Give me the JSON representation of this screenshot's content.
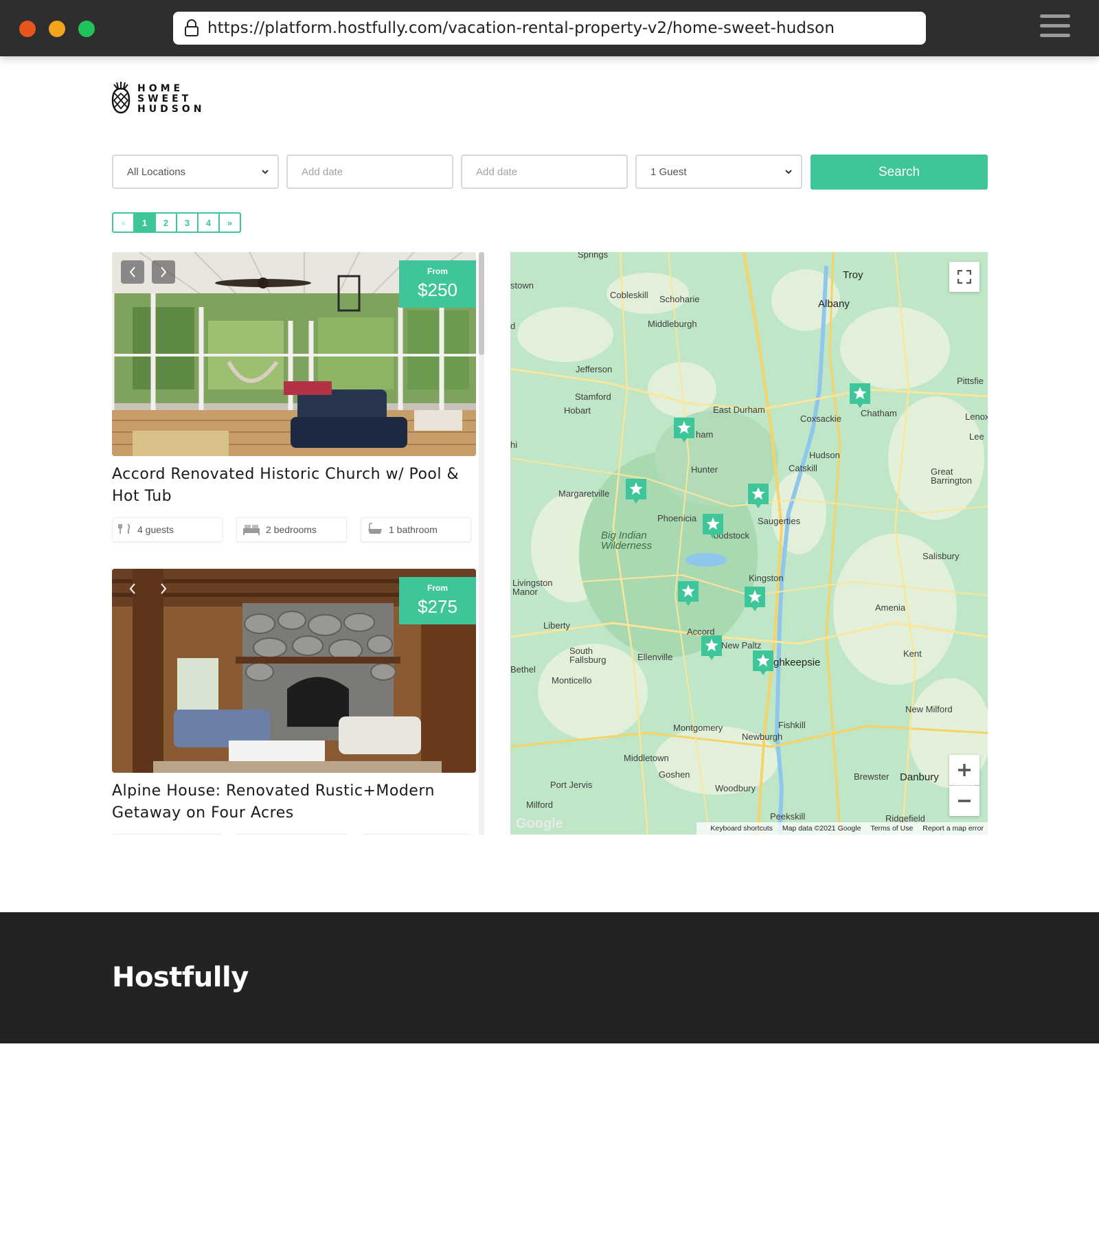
{
  "browser": {
    "url": "https://platform.hostfully.com/vacation-rental-property-v2/home-sweet-hudson"
  },
  "brand": {
    "line1": "HOME",
    "line2": "SWEET",
    "line3": "HUDSON"
  },
  "search": {
    "location_value": "All Locations",
    "checkin_placeholder": "Add date",
    "checkout_placeholder": "Add date",
    "guests_value": "1 Guest",
    "button_label": "Search"
  },
  "pagination": {
    "prev": "«",
    "pages": [
      "1",
      "2",
      "3",
      "4"
    ],
    "next": "»",
    "active": "1"
  },
  "listings": [
    {
      "price_prefix": "From",
      "price": "$250",
      "title": "Accord Renovated Historic Church w/ Pool & Hot Tub",
      "guests": "4 guests",
      "bedrooms": "2 bedrooms",
      "bathrooms": "1 bathroom"
    },
    {
      "price_prefix": "From",
      "price": "$275",
      "title": "Alpine House: Renovated Rustic+Modern Getaway on Four Acres"
    }
  ],
  "map": {
    "labels": {
      "springs": "Springs",
      "stown": "stown",
      "cobleskill": "Cobleskill",
      "schoharie": "Schoharie",
      "middleburgh": "Middleburgh",
      "troy": "Troy",
      "albany": "Albany",
      "jefferson": "Jefferson",
      "stamford": "Stamford",
      "hobart": "Hobart",
      "east_durham": "East Durham",
      "coxsackie": "Coxsackie",
      "chatham": "Chatham",
      "pittsfield": "Pittsfie",
      "lenox": "Lenox",
      "lee": "Lee",
      "durham": "ham",
      "hunter": "Hunter",
      "catskill": "Catskill",
      "hudson": "Hudson",
      "great_barrington": "Great Barrington",
      "margaretville": "Margaretville",
      "phoenicia": "Phoenicia",
      "saugerties": "Saugerties",
      "woodstock": "oodstock",
      "big_indian": "Big Indian Wilderness",
      "salisbury": "Salisbury",
      "kingston": "Kingston",
      "livingston_manor": "Livingston Manor",
      "amenia": "Amenia",
      "liberty": "Liberty",
      "accord": "Accord",
      "new_paltz": "New Paltz",
      "kent": "Kent",
      "south_fallsburg": "South Fallsburg",
      "ellenville": "Ellenville",
      "poughkeepsie": "ghkeepsie",
      "bethel": "Bethel",
      "monticello": "Monticello",
      "new_milford": "New Milford",
      "montgomery": "Montgomery",
      "fishkill": "Fishkill",
      "newburgh": "Newburgh",
      "middletown": "Middletown",
      "goshen": "Goshen",
      "brewster": "Brewster",
      "danbury": "Danbury",
      "port_jervis": "Port Jervis",
      "woodbury": "Woodbury",
      "milford": "Milford",
      "peekskill": "Peekskill",
      "ridgefield": "Ridgefield",
      "hi": "hi",
      "d": "d"
    },
    "footer": {
      "shortcuts": "Keyboard shortcuts",
      "data": "Map data ©2021 Google",
      "terms": "Terms of Use",
      "report": "Report a map error"
    },
    "google_logo": "Google",
    "marker_color": "#3fc59a"
  },
  "footer": {
    "logo": "Hostfully"
  },
  "colors": {
    "accent": "#3fc59a",
    "chrome": "#2e2e2f",
    "footer": "#232325"
  },
  "icons": [
    "lock-icon",
    "hamburger-icon",
    "pineapple-logo-icon",
    "chevron-down-icon",
    "arrow-left-icon",
    "arrow-right-icon",
    "guests-icon",
    "bed-icon",
    "bathtub-icon",
    "map-star-marker-icon",
    "fullscreen-icon",
    "zoom-in-icon",
    "zoom-out-icon"
  ]
}
